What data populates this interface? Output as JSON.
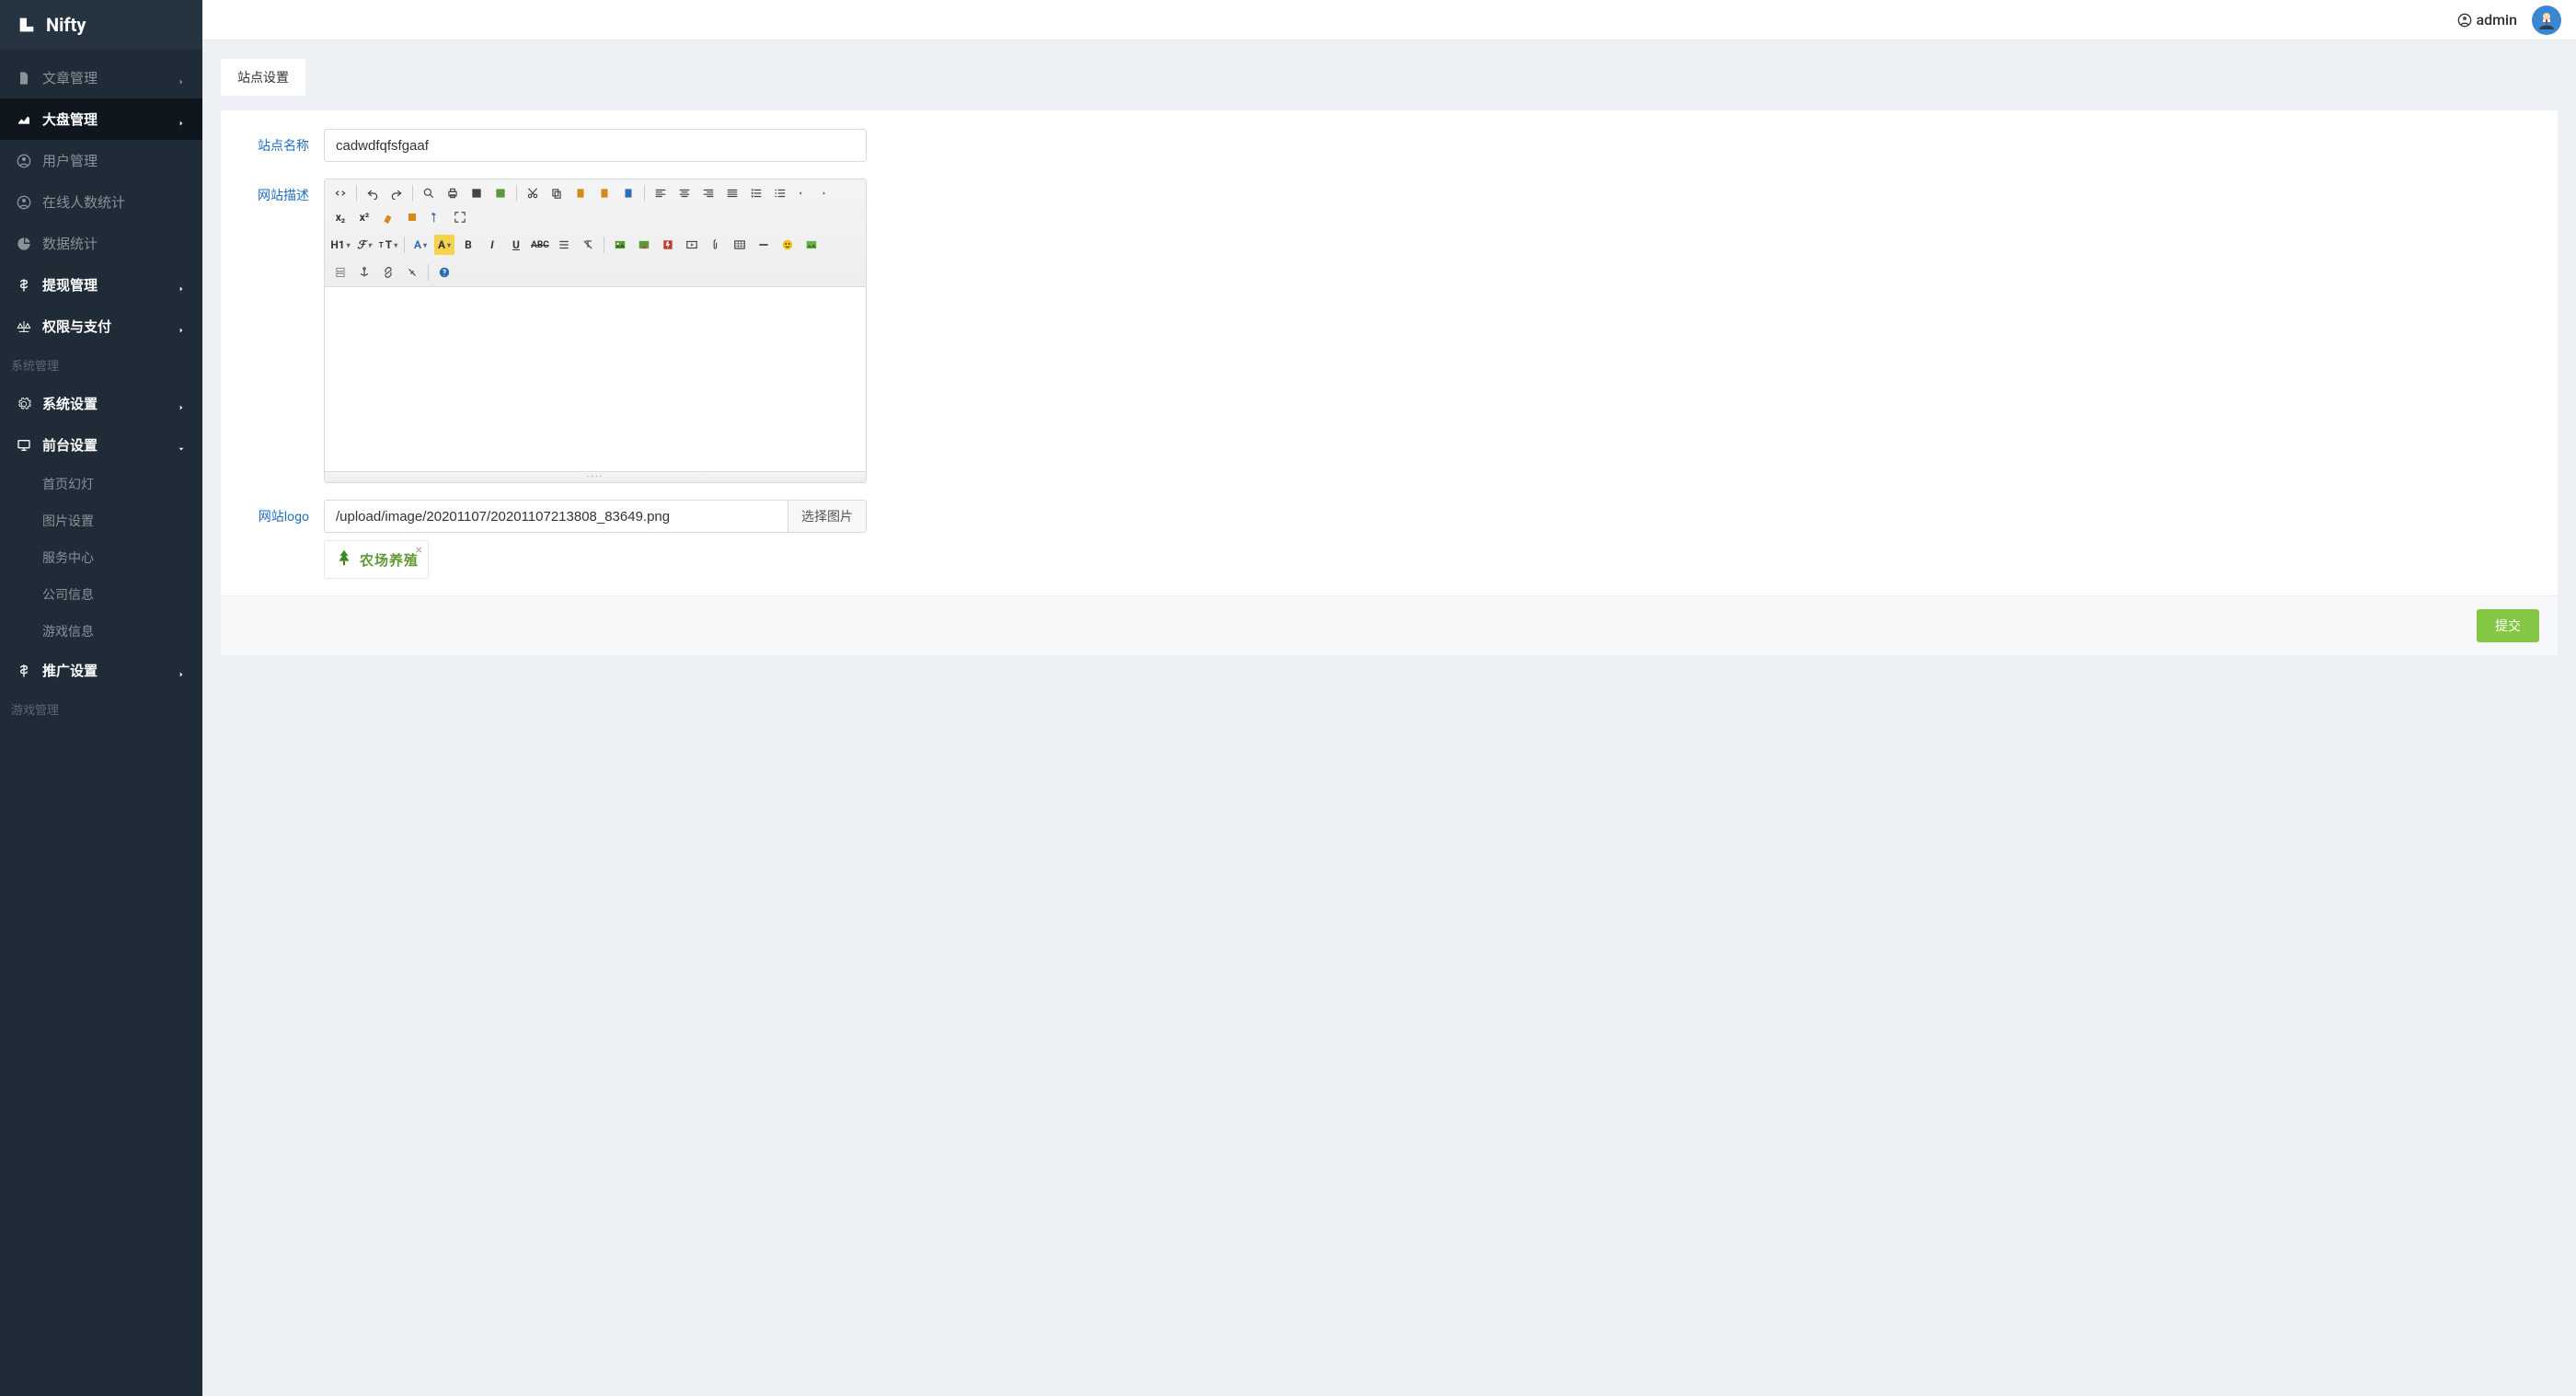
{
  "brand": {
    "name": "Nifty"
  },
  "topbar": {
    "user_label": "admin"
  },
  "sidebar": {
    "items": [
      {
        "label": "文章管理",
        "icon": "file",
        "expandable": true
      },
      {
        "label": "大盘管理",
        "icon": "chart-line",
        "expandable": true,
        "boldbg": true
      },
      {
        "label": "用户管理",
        "icon": "user-circle",
        "expandable": false
      },
      {
        "label": "在线人数统计",
        "icon": "user-circle",
        "expandable": false
      },
      {
        "label": "数据统计",
        "icon": "pie-chart",
        "expandable": false
      },
      {
        "label": "提现管理",
        "icon": "dollar",
        "expandable": true
      },
      {
        "label": "权限与支付",
        "icon": "balance",
        "expandable": true
      }
    ],
    "section1_title": "系统管理",
    "items2": [
      {
        "label": "系统设置",
        "icon": "gear",
        "expandable": true
      },
      {
        "label": "前台设置",
        "icon": "monitor",
        "expandable": true,
        "expanded": true
      }
    ],
    "subitems_front": [
      {
        "label": "首页幻灯"
      },
      {
        "label": "图片设置"
      },
      {
        "label": "服务中心"
      },
      {
        "label": "公司信息"
      },
      {
        "label": "游戏信息"
      }
    ],
    "items3": [
      {
        "label": "推广设置",
        "icon": "dollar",
        "expandable": true
      }
    ],
    "section2_title": "游戏管理"
  },
  "tab": {
    "label": "站点设置"
  },
  "form": {
    "site_name_label": "站点名称",
    "site_name_value": "cadwdfqfsfgaaf",
    "site_desc_label": "网站描述",
    "editor_body": "",
    "site_logo_label": "网站logo",
    "site_logo_value": "/upload/image/20201107/20201107213808_83649.png",
    "choose_image_label": "选择图片",
    "logo_preview_text": "农场养殖",
    "thumb_close": "×",
    "resize_handle": "····"
  },
  "footer": {
    "submit_label": "提交"
  },
  "editor_toolbar": {
    "row1": [
      "source",
      "undo",
      "redo",
      "preview",
      "print",
      "template",
      "code",
      "cut",
      "copy",
      "paste",
      "paste-text",
      "paste-word",
      "align-left",
      "align-center",
      "align-right",
      "align-justify",
      "list-ol",
      "list-ul",
      "outdent",
      "indent",
      "subscript",
      "superscript"
    ],
    "row2": [
      "sup2",
      "clean",
      "quickformat",
      "select-all",
      "fullscreen"
    ],
    "row3": [
      "h1",
      "font-family",
      "font-size",
      "font-color",
      "bg-color",
      "bold",
      "italic",
      "underline",
      "strike",
      "linethrough",
      "remove-format",
      "image",
      "multi-image",
      "flash",
      "media",
      "attach",
      "table",
      "hr",
      "emoji",
      "map"
    ],
    "row4": [
      "baidumap",
      "anchor",
      "link",
      "unlink",
      "about"
    ]
  }
}
